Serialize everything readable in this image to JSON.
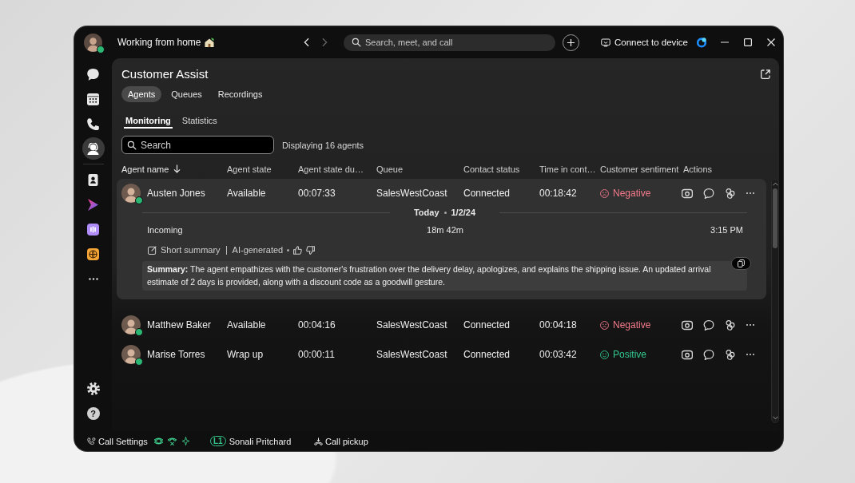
{
  "title_bar": {
    "avatar_online": true,
    "status": "Working from home",
    "nav": {
      "back_disabled": false,
      "forward_disabled": true
    },
    "search": {
      "placeholder": "Search, meet, and call"
    },
    "connect_button": "Connect to device"
  },
  "sidebar": {
    "top": [
      {
        "kind": "chat",
        "selected": false
      },
      {
        "kind": "calendar",
        "selected": false
      },
      {
        "kind": "calls",
        "selected": false
      },
      {
        "kind": "assist",
        "selected": true
      }
    ],
    "apps": [
      {
        "kind": "contacts",
        "selected": false
      },
      {
        "kind": "media",
        "selected": false
      },
      {
        "kind": "meter",
        "selected": false
      },
      {
        "kind": "web",
        "selected": false
      },
      {
        "kind": "more",
        "selected": false
      }
    ],
    "help": "?"
  },
  "panel": {
    "title": "Customer Assist",
    "tabs": [
      {
        "label": "Agents",
        "selected": true
      },
      {
        "label": "Queues",
        "selected": false
      },
      {
        "label": "Recordings",
        "selected": false
      }
    ],
    "subtabs": [
      {
        "label": "Monitoring",
        "selected": true
      },
      {
        "label": "Statistics",
        "selected": false
      }
    ],
    "search": {
      "placeholder": "Search"
    },
    "count": "Displaying 16 agents"
  },
  "table": {
    "columns": [
      {
        "label": "Agent name",
        "sorted": true
      },
      {
        "label": "Agent state",
        "sorted": false
      },
      {
        "label": "Agent state du…",
        "sorted": false
      },
      {
        "label": "Queue",
        "sorted": false
      },
      {
        "label": "Contact status",
        "sorted": false
      },
      {
        "label": "Time in cont…",
        "sorted": false
      },
      {
        "label": "Customer sentiment",
        "sorted": false
      },
      {
        "label": "Actions",
        "sorted": false
      }
    ],
    "rows": [
      {
        "name": "Austen Jones",
        "online": true,
        "state": "Available",
        "state_duration": "00:07:33",
        "queue": "SalesWestCoast",
        "contact_status": "Connected",
        "time_in_contact": "00:18:42",
        "sentiment": {
          "label": "Negative",
          "kind": "negative"
        },
        "expanded": true,
        "details": {
          "date_label": "Today",
          "date": "1/2/24",
          "direction": "Incoming",
          "duration": "18m 42m",
          "time": "3:15 PM",
          "summary_title": "Short summary",
          "summary_source": "AI-generated",
          "summary": "**Summary:** The agent empathizes with the customer's frustration over the delivery delay, apologizes, and explains the shipping issue. An updated arrival estimate of 2 days is provided, along with a discount code as a goodwill gesture."
        }
      },
      {
        "name": "Matthew Baker",
        "online": true,
        "state": "Available",
        "state_duration": "00:04:16",
        "queue": "SalesWestCoast",
        "contact_status": "Connected",
        "time_in_contact": "00:04:18",
        "sentiment": {
          "label": "Negative",
          "kind": "negative"
        },
        "expanded": false
      },
      {
        "name": "Marise Torres",
        "online": true,
        "state": "Wrap up",
        "state_duration": "00:00:11",
        "queue": "SalesWestCoast",
        "contact_status": "Connected",
        "time_in_contact": "00:03:42",
        "sentiment": {
          "label": "Positive",
          "kind": "positive"
        },
        "expanded": false
      }
    ]
  },
  "bottom_bar": {
    "call_settings": "Call Settings",
    "line": {
      "badge": "L1",
      "name": "Sonali Pritchard"
    },
    "call_pickup": "Call pickup"
  }
}
